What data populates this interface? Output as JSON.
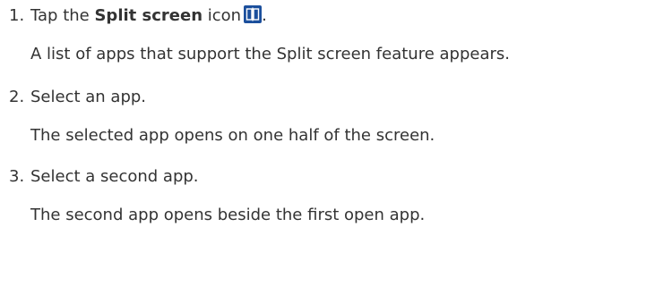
{
  "steps": [
    {
      "number": "1.",
      "text_before": "Tap the ",
      "text_bold": "Split screen",
      "text_after": " icon",
      "text_end": ".",
      "icon": "split-screen-icon",
      "result": "A list of apps that support the Split screen feature appears."
    },
    {
      "number": "2.",
      "text": "Select an app.",
      "result": "The selected app opens on one half of the screen."
    },
    {
      "number": "3.",
      "text": "Select a second app.",
      "result": "The second app opens beside the first open app."
    }
  ],
  "colors": {
    "text": "#333333",
    "icon_background": "#1b4f9c",
    "icon_foreground": "#ffffff"
  }
}
